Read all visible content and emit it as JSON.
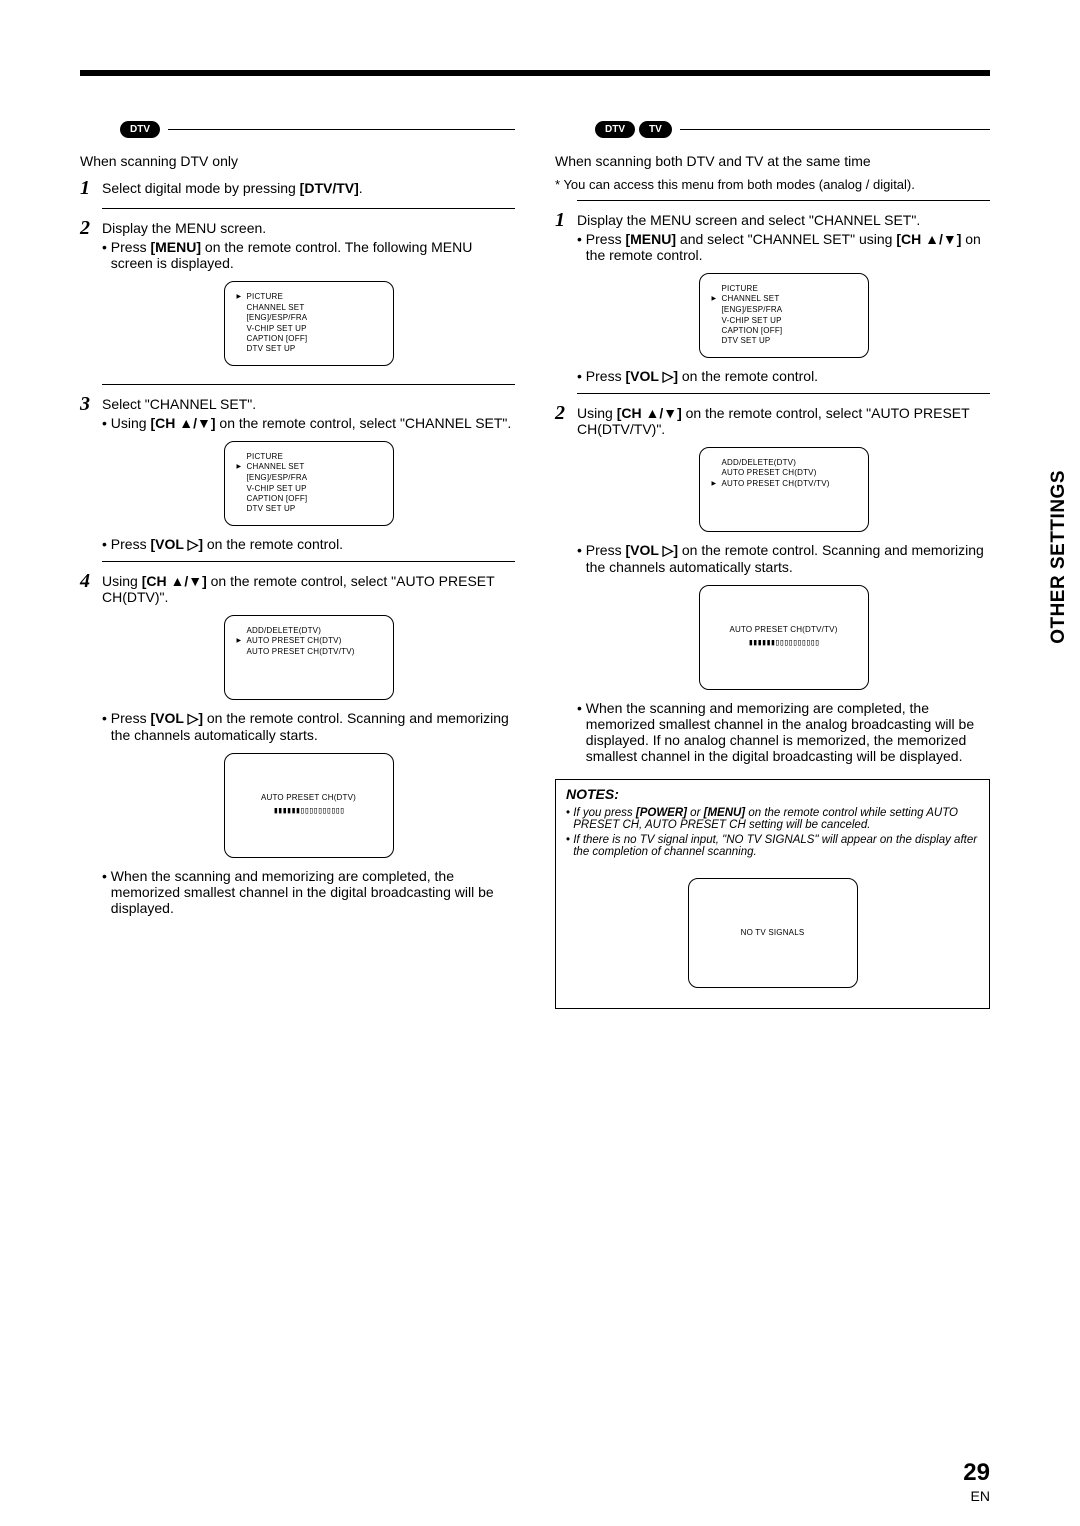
{
  "tags": {
    "dtv": "DTV",
    "tv": "TV"
  },
  "left": {
    "intro": "When scanning DTV only",
    "s1": "Select digital mode by pressing [DTV/TV].",
    "s1_b": "[DTV/TV]",
    "s2": "Display the MENU screen.",
    "s2b1_a": "Press ",
    "s2b1_m": "[MENU]",
    "s2b1_b": " on the remote control. The following MENU screen is displayed.",
    "s3": "Select \"CHANNEL SET\".",
    "s3b1_a": "Using ",
    "s3b1_m": "[CH ▲/▼]",
    "s3b1_b": " on the remote control, select \"CHANNEL SET\".",
    "s3b2_a": "Press ",
    "s3b2_m": "[VOL ▷]",
    "s3b2_b": " on the remote control.",
    "s4_a": "Using ",
    "s4_m": "[CH ▲/▼]",
    "s4_b": " on the remote control, select \"AUTO PRESET CH(DTV)\".",
    "s4b1_a": "Press ",
    "s4b1_m": "[VOL ▷]",
    "s4b1_b": " on the remote control. Scanning and memorizing the channels automatically starts.",
    "s4b2": "When the scanning and memorizing are completed, the memorized smallest channel in the digital broadcasting will be displayed."
  },
  "right": {
    "intro": "When scanning both DTV and TV at the same time",
    "note_pre": "* ",
    "note": "You can access this menu from both modes (analog / digital).",
    "s1": "Display the MENU screen and select \"CHANNEL SET\".",
    "s1b1_a": "Press ",
    "s1b1_m": "[MENU]",
    "s1b1_b": " and select \"CHANNEL SET\" using ",
    "s1b1_m2": "[CH ▲/▼]",
    "s1b1_c": " on the remote control.",
    "s1b2_a": "Press ",
    "s1b2_m": "[VOL ▷]",
    "s1b2_b": " on the remote control.",
    "s2_a": "Using ",
    "s2_m": "[CH ▲/▼]",
    "s2_b": " on the remote control, select \"AUTO PRESET CH(DTV/TV)\".",
    "s2b1_a": "Press ",
    "s2b1_m": "[VOL ▷]",
    "s2b1_b": " on the remote control. Scanning and memorizing the channels automatically starts.",
    "s2b2": "When the scanning and memorizing are completed, the memorized smallest channel in the analog broadcasting will be displayed. If no analog channel is memorized, the memorized smallest channel in the digital broadcasting will be displayed."
  },
  "osd": {
    "menu": [
      "PICTURE",
      "CHANNEL SET",
      "[ENG]/ESP/FRA",
      "V-CHIP SET UP",
      "CAPTION [OFF]",
      "DTV SET UP"
    ],
    "menu_sel_picture": 0,
    "menu_sel_channel": 1,
    "preset_menu": [
      "ADD/DELETE(DTV)",
      "AUTO PRESET CH(DTV)",
      "AUTO PRESET CH(DTV/TV)"
    ],
    "preset_dtv_sel": 1,
    "preset_dtvtv_sel": 2,
    "scan_dtv": "AUTO PRESET CH(DTV)",
    "scan_dtvtv": "AUTO PRESET CH(DTV/TV)",
    "progress": "▮▮▮▮▮▮▯▯▯▯▯▯▯▯▯▯",
    "no_signal": "NO TV SIGNALS"
  },
  "notes": {
    "header": "NOTES:",
    "n1_a": "If you press ",
    "n1_m": "[POWER]",
    "n1_b": " or ",
    "n1_m2": "[MENU]",
    "n1_c": " on the remote control while setting AUTO PRESET CH, AUTO PRESET CH setting will be canceled.",
    "n2": "If there is no TV signal input, \"NO TV SIGNALS\" will appear on the display after the completion of channel scanning."
  },
  "side": "OTHER SETTINGS",
  "page": "29",
  "lang": "EN"
}
